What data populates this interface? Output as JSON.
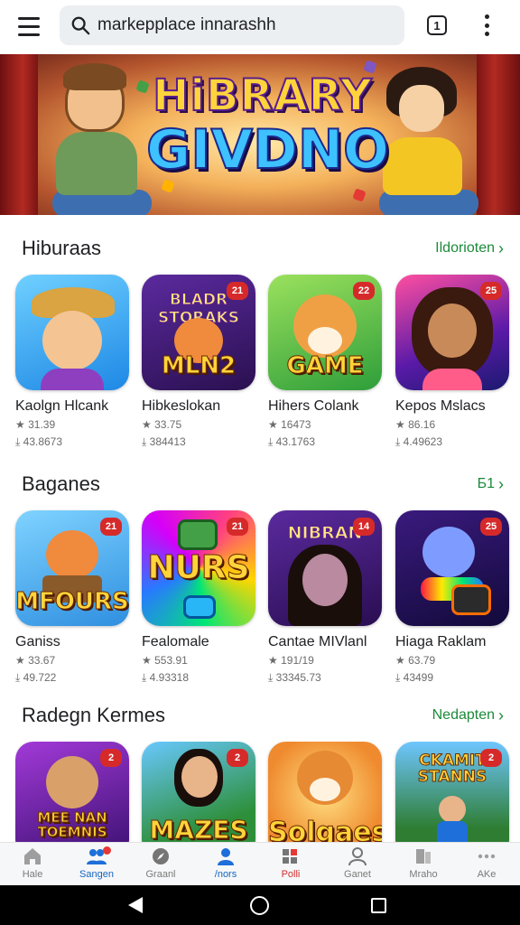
{
  "search": {
    "query": "markepplace innarashh"
  },
  "toolbar": {
    "tab_count": "1"
  },
  "banner": {
    "title_line1": "HiBRARY",
    "title_line2": "GIVDNO"
  },
  "sections": [
    {
      "title": "Hiburaas",
      "more": "Ildorioten",
      "apps": [
        {
          "name": "Kaolgn Hlcank",
          "rating": "31.39",
          "downloads": "43.8673",
          "icon": "cowboy-kid-icon",
          "icon_text_top": "",
          "icon_text": "",
          "badge": ""
        },
        {
          "name": "Hibkeslokan",
          "rating": "33.75",
          "downloads": "384413",
          "icon": "fox-tv-icon",
          "icon_text_top": "BLADR STORAKS",
          "icon_text": "MLN2",
          "badge": "21"
        },
        {
          "name": "Hihers Colank",
          "rating": "16473",
          "downloads": "43.1763",
          "icon": "shiba-dog-icon",
          "icon_text_top": "",
          "icon_text": "GAME",
          "badge": "22"
        },
        {
          "name": "Kepos Mslacs",
          "rating": "86.16",
          "downloads": "4.49623",
          "icon": "girl-curly-hair-icon",
          "icon_text_top": "",
          "icon_text": "",
          "badge": "25"
        }
      ]
    },
    {
      "title": "Baganes",
      "more": "Б1",
      "apps": [
        {
          "name": "Ganiss",
          "rating": "33.67",
          "downloads": "49.722",
          "icon": "fox-chest-icon",
          "icon_text_top": "",
          "icon_text": "MFOURS",
          "badge": "21"
        },
        {
          "name": "Fealomale",
          "rating": "553.91",
          "downloads": "4.93318",
          "icon": "puzzle-blocks-icon",
          "icon_text_top": "",
          "icon_text": "NURS",
          "badge": "21"
        },
        {
          "name": "Cantae MIVlanl",
          "rating": "191/19",
          "downloads": "33345.73",
          "icon": "girl-portrait-icon",
          "icon_text_top": "NIBRAN",
          "icon_text": "",
          "badge": "14"
        },
        {
          "name": "Hiaga Raklam",
          "rating": "63.79",
          "downloads": "43499",
          "icon": "cat-blaster-icon",
          "icon_text_top": "",
          "icon_text": "",
          "badge": "25"
        }
      ]
    },
    {
      "title": "Radegn Kermes",
      "more": "Nedapten",
      "apps": [
        {
          "name": "",
          "rating": "",
          "downloads": "",
          "icon": "kid-blocks-icon",
          "icon_text_top": "",
          "icon_text": "MEE NAN TOEMNIS",
          "badge": "2"
        },
        {
          "name": "",
          "rating": "",
          "downloads": "",
          "icon": "girl-jungle-icon",
          "icon_text_top": "",
          "icon_text": "MAZES",
          "badge": "2"
        },
        {
          "name": "",
          "rating": "",
          "downloads": "",
          "icon": "shiba-dog-icon",
          "icon_text_top": "",
          "icon_text": "Solgaes",
          "badge": ""
        },
        {
          "name": "",
          "rating": "",
          "downloads": "",
          "icon": "boy-jungle-icon",
          "icon_text_top": "CKAMIT STANNS",
          "icon_text": "",
          "badge": "2"
        }
      ]
    }
  ],
  "bottom_nav": [
    {
      "label": "Hale",
      "icon": "home-icon"
    },
    {
      "label": "Sangen",
      "icon": "people-icon"
    },
    {
      "label": "Graanl",
      "icon": "compass-icon"
    },
    {
      "label": "/nors",
      "icon": "person-icon"
    },
    {
      "label": "Polli",
      "icon": "apps-icon"
    },
    {
      "label": "Ganet",
      "icon": "account-icon"
    },
    {
      "label": "Mraho",
      "icon": "library-icon"
    },
    {
      "label": "AKe",
      "icon": "more-icon"
    }
  ],
  "colors": {
    "accent_green": "#1b8a3a",
    "active_blue": "#1565c0",
    "alert_red": "#d32f2f"
  }
}
